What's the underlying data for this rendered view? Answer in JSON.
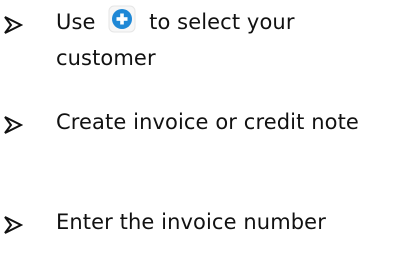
{
  "bullets": [
    {
      "text_before": "Use",
      "icon": "plus-circle-icon",
      "text_after": "to select your customer"
    },
    {
      "text": "Create invoice or credit note"
    },
    {
      "text": "Enter the invoice number"
    }
  ],
  "colors": {
    "text": "#111111",
    "icon_fill": "#1f88d6",
    "icon_border": "#e6e6e6"
  }
}
